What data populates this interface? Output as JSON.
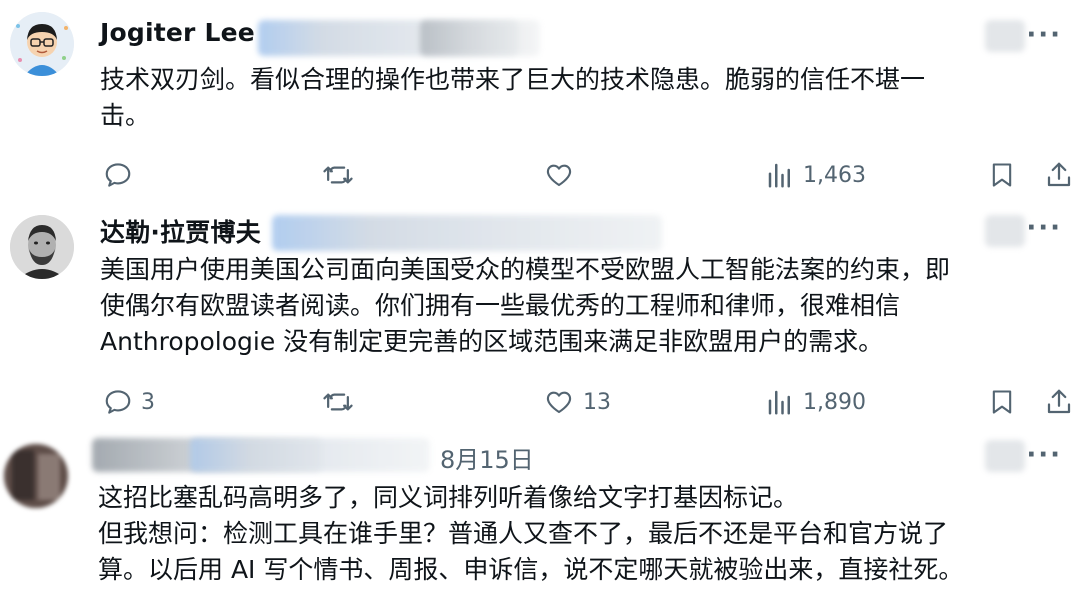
{
  "tweets": [
    {
      "author": "Jogiter Lee",
      "text": [
        "技术双刃剑。看似合理的操作也带来了巨大的技术隐患。脆弱的信任不堪一",
        "击。"
      ],
      "replies": "",
      "likes": "",
      "views": "1,463"
    },
    {
      "author": "达勒·拉贾博夫",
      "text": [
        "美国用户使用美国公司面向美国受众的模型不受欧盟人工智能法案的约束，即",
        "使偶尔有欧盟读者阅读。你们拥有一些最优秀的工程师和律师，很难相信",
        "Anthropologie 没有制定更完善的区域范围来满足非欧盟用户的需求。"
      ],
      "replies": "3",
      "likes": "13",
      "views": "1,890"
    },
    {
      "author": "",
      "date": "8月15日",
      "text": [
        "这招比塞乱码高明多了，同义词排列听着像给文字打基因标记。",
        "但我想问：检测工具在谁手里？普通人又查不了，最后不还是平台和官方说了",
        "算。以后用 AI 写个情书、周报、申诉信，说不定哪天就被验出来，直接社死。"
      ]
    }
  ],
  "icons": {
    "reply": "reply-icon",
    "retweet": "retweet-icon",
    "like": "heart-icon",
    "views": "views-icon",
    "bookmark": "bookmark-icon",
    "share": "share-icon",
    "more": "more-icon"
  },
  "more_label": "···"
}
